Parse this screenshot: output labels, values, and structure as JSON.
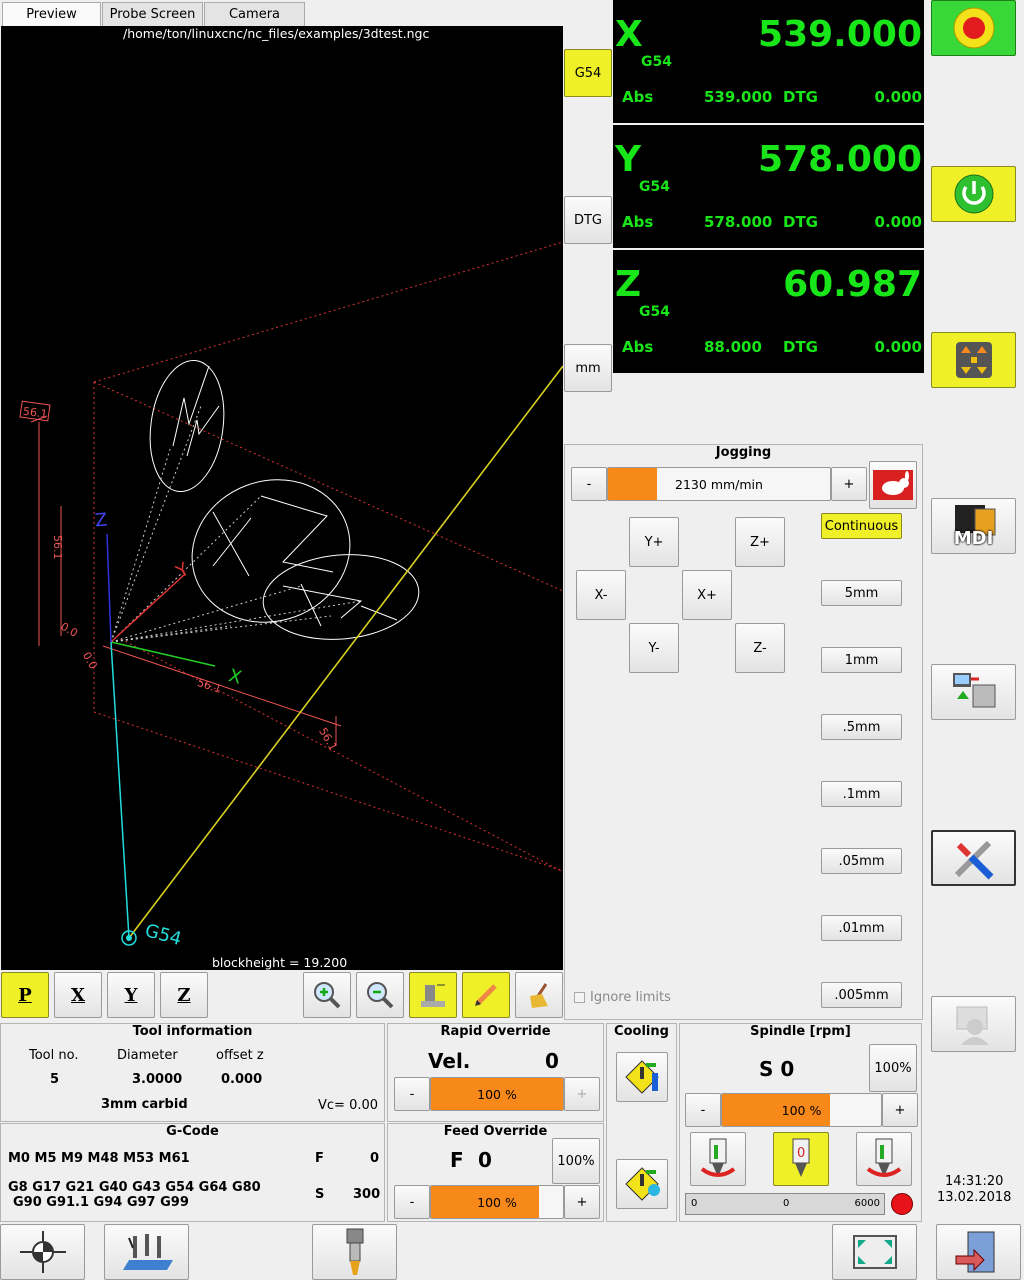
{
  "tabs": [
    "Preview",
    "Probe Screen",
    "Camera"
  ],
  "preview": {
    "file_path": "/home/ton/linuxcnc/nc_files/examples/3dtest.ngc",
    "blockheight": "blockheight = 19.200",
    "g54_label": "G54",
    "dim_label": "56.1",
    "zero_label": "0.0",
    "axis_x": "X",
    "axis_y": "Y",
    "axis_z": "Z"
  },
  "view_buttons": {
    "p": "P",
    "x": "X",
    "y": "Y",
    "z": "Z"
  },
  "side_buttons": {
    "g54": "G54",
    "dtg": "DTG",
    "mm": "mm"
  },
  "dro": [
    {
      "axis": "X",
      "offset": "G54",
      "value": "539.000",
      "abs_label": "Abs",
      "abs": "539.000",
      "dtg_label": "DTG",
      "dtg": "0.000"
    },
    {
      "axis": "Y",
      "offset": "G54",
      "value": "578.000",
      "abs_label": "Abs",
      "abs": "578.000",
      "dtg_label": "DTG",
      "dtg": "0.000"
    },
    {
      "axis": "Z",
      "offset": "G54",
      "value": "60.987",
      "abs_label": "Abs",
      "abs": "88.000",
      "dtg_label": "DTG",
      "dtg": "0.000"
    }
  ],
  "jogging": {
    "title": "Jogging",
    "minus": "-",
    "plus": "+",
    "rate": "2130 mm/min",
    "rate_fraction": 0.22,
    "yplus": "Y+",
    "yminus": "Y-",
    "xplus": "X+",
    "xminus": "X-",
    "zplus": "Z+",
    "zminus": "Z-",
    "increments": [
      "Continuous",
      "5mm",
      "1mm",
      ".5mm",
      ".1mm",
      ".05mm",
      ".01mm",
      ".005mm"
    ],
    "ignore_limits": "Ignore limits"
  },
  "right_buttons": {
    "mdi": "MDI"
  },
  "tool": {
    "title": "Tool information",
    "h_no": "Tool no.",
    "h_dia": "Diameter",
    "h_off": "offset z",
    "no": "5",
    "dia": "3.0000",
    "off": "0.000",
    "desc": "3mm carbid",
    "vc": "Vc= 0.00"
  },
  "gcode": {
    "title": "G-Code",
    "mcodes": "M0 M5 M9 M48 M53 M61",
    "gline1": "G8 G17 G21 G40 G43 G54 G64 G80",
    "gline2": "G90 G91.1 G94 G97 G99",
    "f_label": "F",
    "f_val": "0",
    "s_label": "S",
    "s_val": "300"
  },
  "rapid": {
    "title": "Rapid Override",
    "vel_label": "Vel.",
    "vel": "0",
    "minus": "-",
    "plus": "+",
    "pct": "100 %",
    "fraction": 1.0
  },
  "feed": {
    "title": "Feed Override",
    "f_label": "F",
    "f_val": "0",
    "btn": "100%",
    "minus": "-",
    "plus": "+",
    "pct": "100 %",
    "fraction": 0.82
  },
  "cooling": {
    "title": "Cooling"
  },
  "spindle": {
    "title": "Spindle [rpm]",
    "s_val": "S 0",
    "btn": "100%",
    "minus": "-",
    "plus": "+",
    "pct": "100 %",
    "fraction": 0.68,
    "bar_min": "0",
    "bar_mid": "0",
    "bar_max": "6000"
  },
  "status": {
    "time": "14:31:20",
    "date": "13.02.2018"
  },
  "colors": {
    "dro_green": "#19e619",
    "accent_yellow": "#f0f028",
    "slider_orange": "#f7891b"
  }
}
